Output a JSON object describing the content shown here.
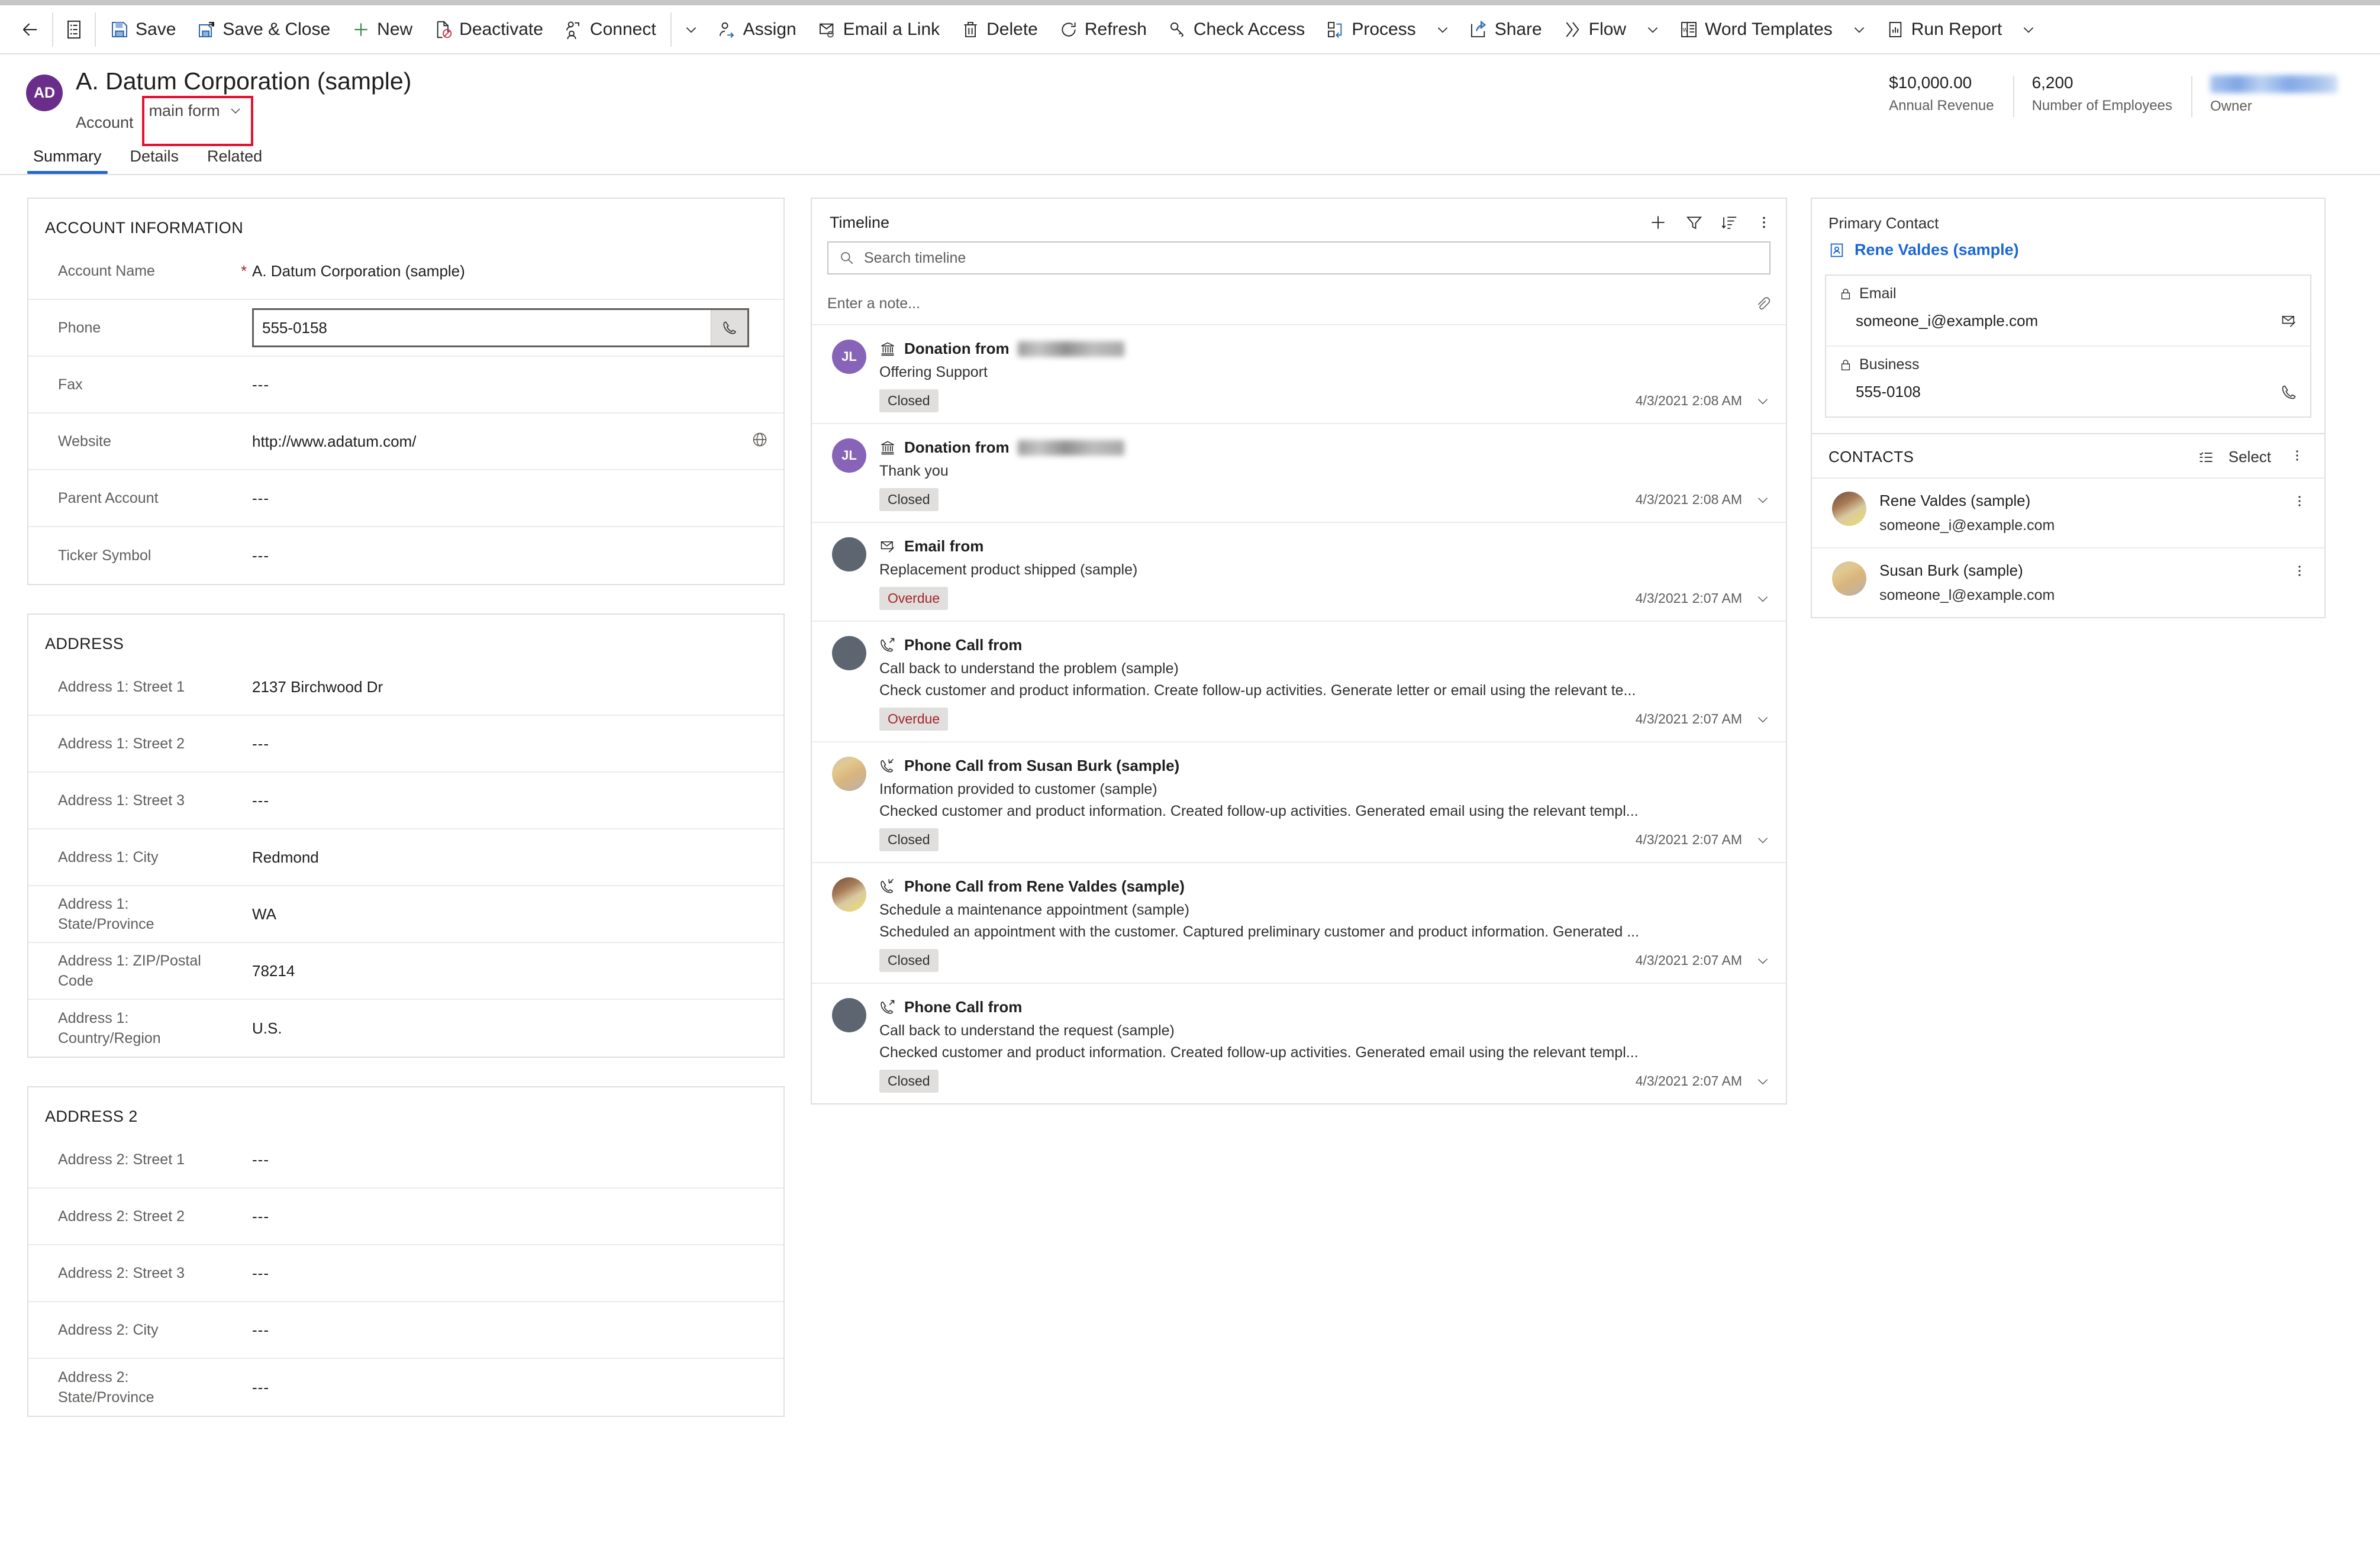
{
  "command_bar": {
    "back_icon": "back-arrow-icon",
    "form_icon": "form-list-icon",
    "buttons": [
      {
        "label": "Save",
        "icon": "save-icon"
      },
      {
        "label": "Save & Close",
        "icon": "save-and-close-icon"
      },
      {
        "label": "New",
        "icon": "plus-icon"
      },
      {
        "label": "Deactivate",
        "icon": "deactivate-icon"
      },
      {
        "label": "Connect",
        "icon": "connect-icon",
        "caret": true
      },
      {
        "label": "Assign",
        "icon": "assign-icon"
      },
      {
        "label": "Email a Link",
        "icon": "email-link-icon"
      },
      {
        "label": "Delete",
        "icon": "delete-icon"
      },
      {
        "label": "Refresh",
        "icon": "refresh-icon"
      },
      {
        "label": "Check Access",
        "icon": "key-icon"
      },
      {
        "label": "Process",
        "icon": "process-icon",
        "caret": true
      },
      {
        "label": "Share",
        "icon": "share-icon"
      },
      {
        "label": "Flow",
        "icon": "flow-icon",
        "caret": true
      },
      {
        "label": "Word Templates",
        "icon": "word-icon",
        "caret": true
      },
      {
        "label": "Run Report",
        "icon": "report-icon",
        "caret": true
      }
    ]
  },
  "record_header": {
    "avatar_initials": "AD",
    "title": "A. Datum Corporation (sample)",
    "entity": "Account",
    "form_selector": "main form",
    "stats": [
      {
        "value": "$10,000.00",
        "label": "Annual Revenue"
      },
      {
        "value": "6,200",
        "label": "Number of Employees"
      },
      {
        "value": "",
        "label": "Owner",
        "redacted": true
      }
    ]
  },
  "tabs": [
    {
      "label": "Summary",
      "active": true
    },
    {
      "label": "Details",
      "active": false
    },
    {
      "label": "Related",
      "active": false
    }
  ],
  "account_information": {
    "heading": "ACCOUNT INFORMATION",
    "fields": [
      {
        "label": "Account Name",
        "value": "A. Datum Corporation (sample)",
        "required": true
      },
      {
        "label": "Phone",
        "value": "555-0158",
        "focused": true,
        "action_icon": "phone-call-icon"
      },
      {
        "label": "Fax",
        "value": "---"
      },
      {
        "label": "Website",
        "value": "http://www.adatum.com/",
        "action_icon": "globe-icon"
      },
      {
        "label": "Parent Account",
        "value": "---"
      },
      {
        "label": "Ticker Symbol",
        "value": "---"
      }
    ]
  },
  "address1": {
    "heading": "ADDRESS",
    "fields": [
      {
        "label": "Address 1: Street 1",
        "value": "2137 Birchwood Dr"
      },
      {
        "label": "Address 1: Street 2",
        "value": "---"
      },
      {
        "label": "Address 1: Street 3",
        "value": "---"
      },
      {
        "label": "Address 1: City",
        "value": "Redmond"
      },
      {
        "label": "Address 1: State/Province",
        "value": "WA"
      },
      {
        "label": "Address 1: ZIP/Postal Code",
        "value": "78214"
      },
      {
        "label": "Address 1: Country/Region",
        "value": "U.S."
      }
    ]
  },
  "address2": {
    "heading": "ADDRESS 2",
    "fields": [
      {
        "label": "Address 2: Street 1",
        "value": "---"
      },
      {
        "label": "Address 2: Street 2",
        "value": "---"
      },
      {
        "label": "Address 2: Street 3",
        "value": "---"
      },
      {
        "label": "Address 2: City",
        "value": "---"
      },
      {
        "label": "Address 2: State/Province",
        "value": "---"
      }
    ]
  },
  "timeline": {
    "title": "Timeline",
    "actions": [
      {
        "name": "add-timeline-record",
        "icon": "plus-icon"
      },
      {
        "name": "filter-timeline",
        "icon": "funnel-icon"
      },
      {
        "name": "sort-timeline",
        "icon": "sort-icon"
      },
      {
        "name": "timeline-more-commands",
        "icon": "kebab-icon"
      }
    ],
    "search_placeholder": "Search timeline",
    "note_placeholder": "Enter a note...",
    "attach_icon": "paperclip-icon",
    "items": [
      {
        "avatar_type": "purple",
        "avatar_initials": "JL",
        "record_icon": "donation-icon",
        "kind": "Donation from",
        "actor_redacted": true,
        "subject": "Offering Support",
        "description": "",
        "status": "Closed",
        "status_kind": "closed",
        "date": "4/3/2021 2:08 AM"
      },
      {
        "avatar_type": "purple",
        "avatar_initials": "JL",
        "record_icon": "donation-icon",
        "kind": "Donation from",
        "actor_redacted": true,
        "subject": "Thank you",
        "description": "",
        "status": "Closed",
        "status_kind": "closed",
        "date": "4/3/2021 2:08 AM"
      },
      {
        "avatar_type": "grey",
        "avatar_initials": "",
        "record_icon": "email-icon",
        "kind": "Email from",
        "actor_redacted": false,
        "subject": "Replacement product shipped (sample)",
        "description": "",
        "status": "Overdue",
        "status_kind": "overdue",
        "date": "4/3/2021 2:07 AM"
      },
      {
        "avatar_type": "grey",
        "avatar_initials": "",
        "record_icon": "phone-outgoing-icon",
        "kind": "Phone Call from",
        "actor_redacted": false,
        "subject": "Call back to understand the problem (sample)",
        "description": "Check customer and product information. Create follow-up activities. Generate letter or email using the relevant te...",
        "status": "Overdue",
        "status_kind": "overdue",
        "date": "4/3/2021 2:07 AM"
      },
      {
        "avatar_type": "photo2",
        "avatar_initials": "",
        "record_icon": "phone-incoming-icon",
        "kind": "Phone Call from Susan Burk (sample)",
        "actor_redacted": false,
        "subject": "Information provided to customer (sample)",
        "description": "Checked customer and product information. Created follow-up activities. Generated email using the relevant templ...",
        "status": "Closed",
        "status_kind": "closed",
        "date": "4/3/2021 2:07 AM"
      },
      {
        "avatar_type": "photo1",
        "avatar_initials": "",
        "record_icon": "phone-incoming-icon",
        "kind": "Phone Call from Rene Valdes (sample)",
        "actor_redacted": false,
        "subject": "Schedule a maintenance appointment (sample)",
        "description": "Scheduled an appointment with the customer. Captured preliminary customer and product information. Generated ...",
        "status": "Closed",
        "status_kind": "closed",
        "date": "4/3/2021 2:07 AM"
      },
      {
        "avatar_type": "grey",
        "avatar_initials": "",
        "record_icon": "phone-outgoing-icon",
        "kind": "Phone Call from",
        "actor_redacted": false,
        "subject": "Call back to understand the request (sample)",
        "description": "Checked customer and product information. Created follow-up activities. Generated email using the relevant templ...",
        "status": "Closed",
        "status_kind": "closed",
        "date": "4/3/2021 2:07 AM"
      }
    ]
  },
  "primary_contact": {
    "heading": "Primary Contact",
    "name": "Rene Valdes (sample)",
    "name_icon": "contact-card-icon",
    "fields": [
      {
        "label": "Email",
        "lock_icon": "lock-icon",
        "value": "someone_i@example.com",
        "action_icon": "email-icon"
      },
      {
        "label": "Business",
        "lock_icon": "lock-icon",
        "value": "555-0108",
        "action_icon": "phone-call-icon"
      }
    ]
  },
  "contacts": {
    "heading": "CONTACTS",
    "select_label": "Select",
    "select_icon": "checklist-icon",
    "more_icon": "kebab-icon",
    "rows": [
      {
        "avatar": "a",
        "name": "Rene Valdes (sample)",
        "email": "someone_i@example.com",
        "menu_icon": "kebab-icon"
      },
      {
        "avatar": "b",
        "name": "Susan Burk (sample)",
        "email": "someone_l@example.com",
        "menu_icon": "kebab-icon"
      }
    ]
  }
}
